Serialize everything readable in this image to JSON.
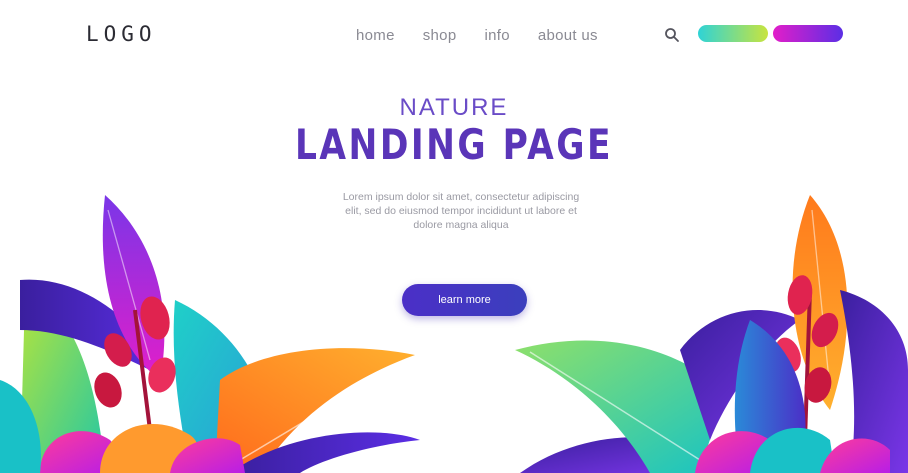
{
  "header": {
    "logo": "LOGO",
    "nav": [
      "home",
      "shop",
      "info",
      "about us"
    ],
    "search_icon": "search-icon",
    "buttons": [
      {
        "label": "",
        "color_from": "#2fd3d6",
        "color_to": "#c8e43e"
      },
      {
        "label": "",
        "color_from": "#e21ec9",
        "color_to": "#5b2ee5"
      }
    ]
  },
  "hero": {
    "eyebrow": "NATURE",
    "title": "LANDING PAGE",
    "body": "Lorem ipsum dolor sit amet, consectetur adipiscing elit, sed do eiusmod tempor incididunt ut labore et dolore magna aliqua",
    "cta": "learn more"
  },
  "colors": {
    "accent": "#5a35b8",
    "cta": "#4b2fc7",
    "teal": "#2fd3d6",
    "magenta": "#e21ec9",
    "orange": "#ff8a1f"
  }
}
